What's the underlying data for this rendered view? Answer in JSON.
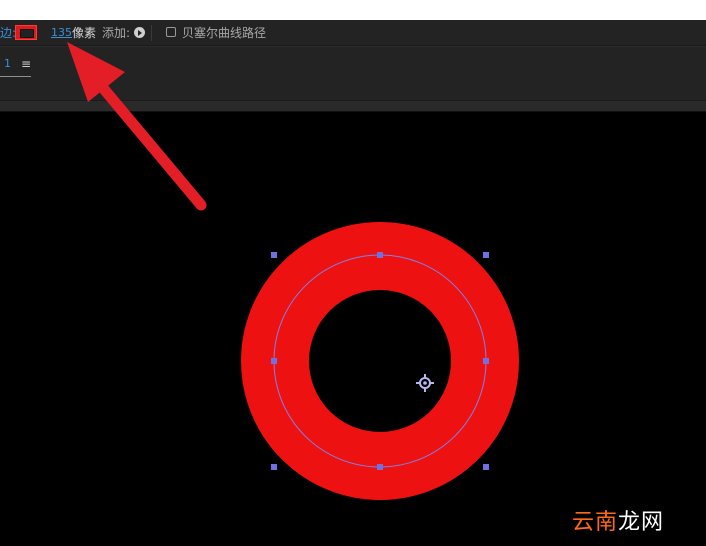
{
  "toolbar": {
    "stroke_label": "边:",
    "stroke_width_value": "135",
    "stroke_unit": "像素",
    "add_label": "添加:",
    "bezier_label": "贝塞尔曲线路径",
    "stroke_color": "#e01a1a"
  },
  "panel": {
    "tab_number": "1",
    "menu_glyph": "≡"
  },
  "canvas": {
    "shape_fill_color": "#ee1111",
    "path_color": "#8080e8",
    "handle_color": "#7070e0",
    "arrow_color": "#e41e26",
    "background": "#000000"
  },
  "watermark": {
    "part1": "云南",
    "part2": "龙网"
  }
}
